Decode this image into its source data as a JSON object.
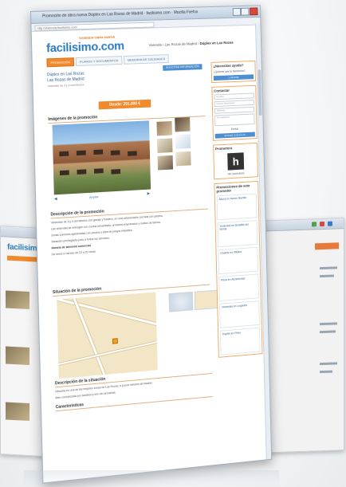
{
  "window": {
    "title": "Promoción de obra nueva Dúplex en Las Rozas de Madrid · facilisimo.com · Mozilla Firefox",
    "url": "http://vivienda.facilisimo.com"
  },
  "header": {
    "logo": "facilisimo.com",
    "tagline": "VIVIENDA OBRA NUEVA",
    "breadcrumb": "Vivienda  ›  Las Rozas de Madrid  ›",
    "breadcrumb_bold": "Dúplex en Las Rozas"
  },
  "tabs": [
    {
      "label": "PROMOCIÓN",
      "active": true
    },
    {
      "label": "PLANOS Y DOCUMENTOS",
      "active": false
    },
    {
      "label": "MEMORIA DE CALIDADES",
      "active": false
    }
  ],
  "listing": {
    "title_line1": "Dúplex en Las Rozas",
    "title_line2": "Las Rozas de Madrid",
    "subtitle": "Viviendas de 3 y 4 dormitorios",
    "contact_button": "SOLICITAR INFORMACIÓN",
    "price": "Desde: 291.000 €"
  },
  "images_section": {
    "heading": "Imágenes de la promoción",
    "caption": "Ampliar",
    "prev": "◄",
    "next": "►"
  },
  "description": {
    "heading": "Descripción de la promoción",
    "p1": "Viviendas de 3 y 4 dormitorios con garaje y trastero, en una urbanización cerrada con piscina.",
    "p2": "Las viviendas se entregan con cocina amueblada, armarios empotrados y suelos de tarima.",
    "p3": "Zonas comunes ajardinadas con piscina y área de juegos infantiles.",
    "p4": "Situación privilegiada junto a todos los servicios.",
    "schedule_title": "Horario de atención comercial",
    "schedule": "De lunes a viernes de 10 a 20 horas"
  },
  "map_section": {
    "heading": "Situación de la promoción"
  },
  "location": {
    "heading": "Descripción de la situación",
    "p1": "Ubicada en una de las mejores zonas de Las Rozas, a pocos minutos de Madrid.",
    "p2": "Bien comunicada por autobús y tren de cercanías.",
    "more": "Características"
  },
  "sidebar": {
    "help_title": "¿Necesitas ayuda?",
    "help_text": "¿Quieres que te llamemos?",
    "help_button": "LLÁMAME",
    "contact_title": "Contactar",
    "fields": [
      "Nombre",
      "Correo electrónico",
      "Teléfono",
      "Comentarios"
    ],
    "contact_note": "Enviar",
    "contact_button": "ENVIAR CONSULTA",
    "promoter_title": "Promotora",
    "promoter_logo": "h",
    "promoter_caption": "Ver promotora",
    "promos_title": "Promociones de este promotor",
    "promos": [
      "Áticos en Nuevo Baztán",
      "Viviendas en Boadilla del Monte",
      "Chalets en Villalba",
      "Pisos en Alcobendas",
      "Viviendas en Leganés",
      "Dúplex en Pinto"
    ]
  },
  "colors": {
    "accent": "#f08a2c",
    "link": "#2b7cc4",
    "button": "#4d8fd0"
  }
}
